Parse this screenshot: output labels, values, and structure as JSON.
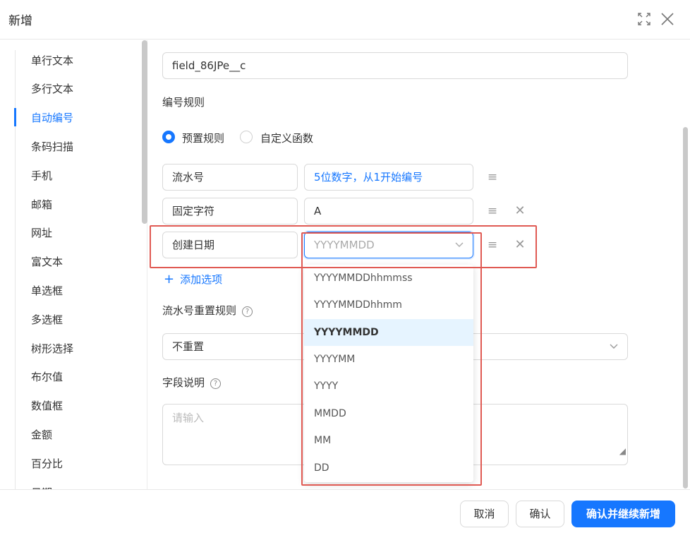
{
  "dialog": {
    "title": "新增"
  },
  "sidebar": {
    "items": [
      {
        "label": "单行文本"
      },
      {
        "label": "多行文本"
      },
      {
        "label": "自动编号",
        "active": true
      },
      {
        "label": "条码扫描"
      },
      {
        "label": "手机"
      },
      {
        "label": "邮箱"
      },
      {
        "label": "网址"
      },
      {
        "label": "富文本"
      },
      {
        "label": "单选框"
      },
      {
        "label": "多选框"
      },
      {
        "label": "树形选择"
      },
      {
        "label": "布尔值"
      },
      {
        "label": "数值框"
      },
      {
        "label": "金额"
      },
      {
        "label": "百分比"
      },
      {
        "label": "日期"
      }
    ]
  },
  "form": {
    "field_api_name": "field_86JPe__c",
    "numbering_rule_label": "编号规则",
    "radio_preset": "预置规则",
    "radio_custom": "自定义函数",
    "rules": [
      {
        "type": "流水号",
        "value": "5位数字，从1开始编号"
      },
      {
        "type": "固定字符",
        "value": "A"
      },
      {
        "type": "创建日期",
        "value": "YYYYMMDD"
      }
    ],
    "add_option": "添加选项",
    "reset_rule_label": "流水号重置规则",
    "reset_rule_value": "不重置",
    "field_desc_label": "字段说明",
    "field_desc_placeholder": "请输入"
  },
  "dropdown": {
    "options": [
      "YYYYMMDDhhmmss",
      "YYYYMMDDhhmm",
      "YYYYMMDD",
      "YYYYMM",
      "YYYY",
      "MMDD",
      "MM",
      "DD"
    ],
    "selected": "YYYYMMDD"
  },
  "footer": {
    "cancel": "取消",
    "confirm": "确认",
    "confirm_continue": "确认并继续新增"
  },
  "colors": {
    "accent": "#1677ff",
    "highlight": "#e05a53",
    "selected_bg": "#e6f4ff"
  }
}
